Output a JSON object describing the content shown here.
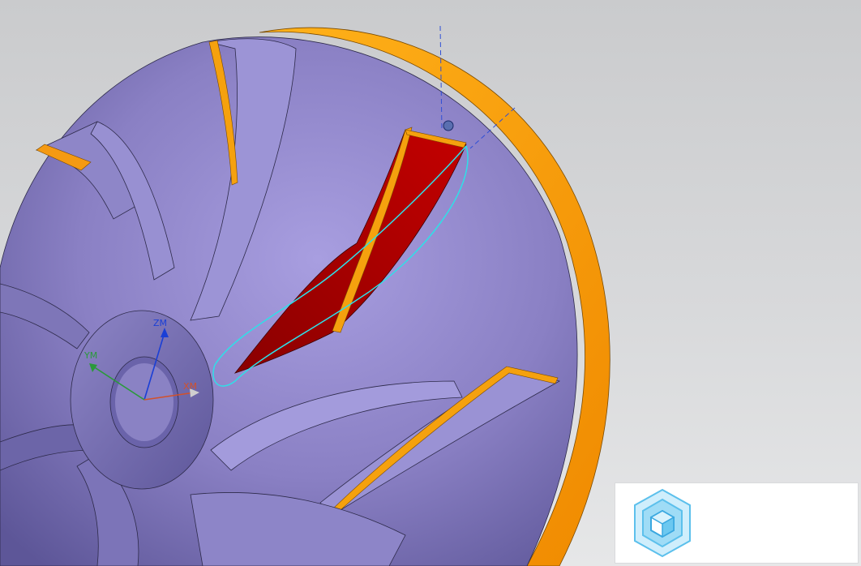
{
  "viewport": {
    "background_top": "#cacbcd",
    "background_bottom": "#e6e7e8"
  },
  "model": {
    "body_color": "#8c84c4",
    "rim_color": "#f5a10e",
    "selected_face_color": "#b30000",
    "edge_highlight_color": "#2ee0e8"
  },
  "triad": {
    "z_label": "ZM",
    "y_label": "YM",
    "x_label": "XM",
    "z_color": "#1a3fd6",
    "y_color": "#2a9a3a",
    "x_color": "#d2512b"
  },
  "logo": {
    "icon": "cube-hexagon-icon",
    "color": "#5cc0ec"
  }
}
